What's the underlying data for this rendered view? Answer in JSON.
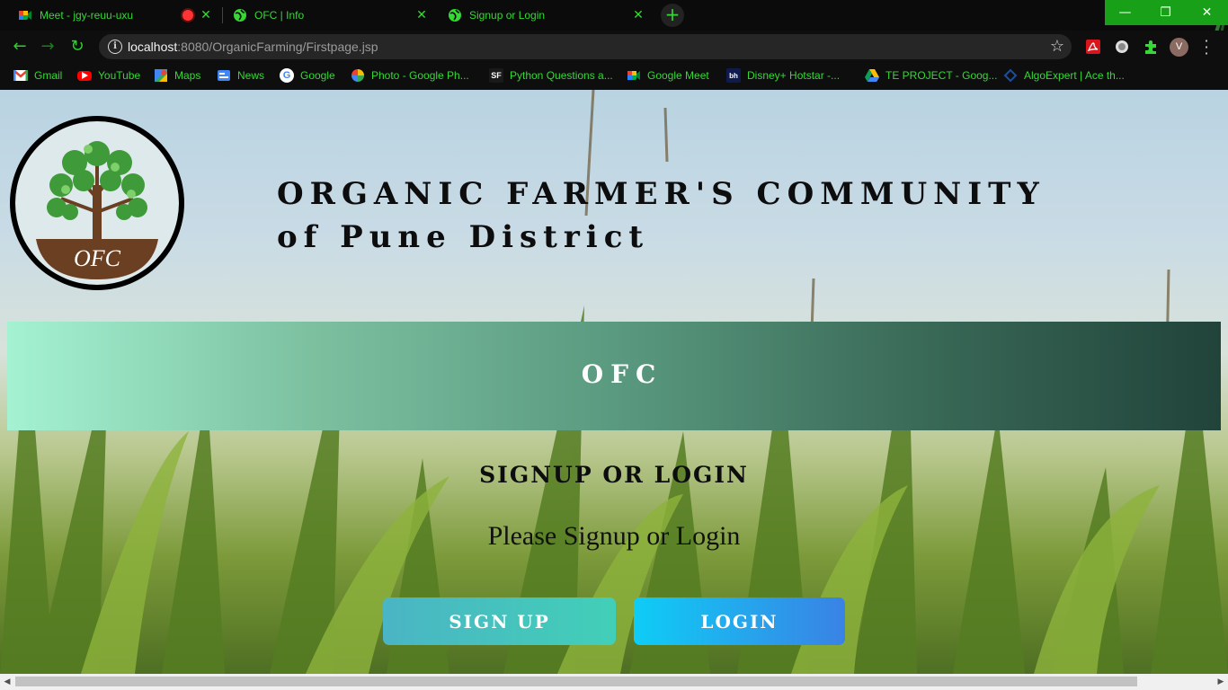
{
  "browser": {
    "tabs": [
      {
        "title": "Meet - jgy-reuu-uxu",
        "favicon": "google-meet-icon",
        "recording": true,
        "active": false
      },
      {
        "title": "OFC | Info",
        "favicon": "globe-icon",
        "active": false
      },
      {
        "title": "Signup or Login",
        "favicon": "globe-icon",
        "active": true
      }
    ],
    "new_tab": "+",
    "window_controls": {
      "minimize": "—",
      "restore": "❐",
      "close": "✕"
    },
    "address": {
      "host": "localhost",
      "path": ":8080/OrganicFarming/Firstpage.jsp"
    },
    "profile_initial": "V",
    "accent_color": "#35d835",
    "bookmarks": [
      {
        "label": "Gmail",
        "icon": "gmail-icon"
      },
      {
        "label": "YouTube",
        "icon": "youtube-icon"
      },
      {
        "label": "Maps",
        "icon": "maps-icon"
      },
      {
        "label": "News",
        "icon": "news-icon"
      },
      {
        "label": "Google",
        "icon": "google-icon"
      },
      {
        "label": "Photo - Google Ph...",
        "icon": "photos-icon"
      },
      {
        "label": "Python Questions a...",
        "icon": "sf-icon"
      },
      {
        "label": "Google Meet",
        "icon": "google-meet-icon"
      },
      {
        "label": "Disney+ Hotstar -...",
        "icon": "hotstar-icon"
      },
      {
        "label": "TE PROJECT - Goog...",
        "icon": "drive-icon"
      },
      {
        "label": "AlgoExpert | Ace th...",
        "icon": "algoexpert-icon"
      }
    ]
  },
  "page": {
    "logo_text": "OFC",
    "heading_line1": "ORGANIC FARMER'S COMMUNITY",
    "heading_line2": "of Pune District",
    "banner_title": "OFC",
    "section_title": "SIGNUP OR LOGIN",
    "section_text": "Please Signup or Login",
    "signup_button": "SIGN UP",
    "login_button": "LOGIN"
  }
}
